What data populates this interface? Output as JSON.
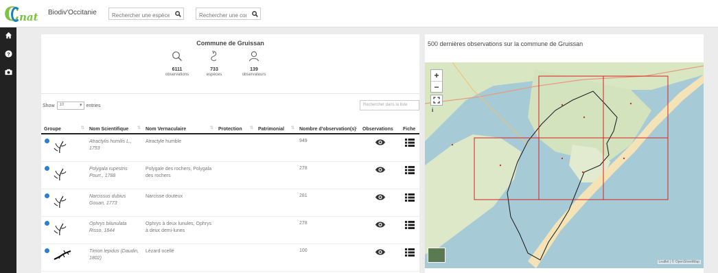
{
  "header": {
    "logo_text": "nat",
    "brand": "Biodiv'Occitanie",
    "search_species_placeholder": "Rechercher une espèce",
    "search_commune_placeholder": "Rechercher une commune"
  },
  "sidebar": {
    "items": [
      {
        "icon": "home-icon"
      },
      {
        "icon": "help-icon"
      },
      {
        "icon": "camera-icon"
      }
    ]
  },
  "commune": {
    "title": "Commune de Gruissan",
    "stats": [
      {
        "value": "6111",
        "label": "observations",
        "icon": "search-icon"
      },
      {
        "value": "733",
        "label": "espèces",
        "icon": "species-icon"
      },
      {
        "value": "139",
        "label": "observateurs",
        "icon": "user-icon"
      }
    ]
  },
  "table": {
    "show_label": "Show",
    "page_size": "10",
    "entries_label": "entries",
    "search_placeholder": "Rechercher dans la liste",
    "columns": {
      "groupe": "Groupe",
      "nom_scientifique": "Nom Scientifique",
      "nom_vernaculaire": "Nom Vernaculaire",
      "protection": "Protection",
      "patrimonial": "Patrimonial",
      "nombre": "Nombre d'observation(s)",
      "observations": "Observations",
      "fiche": "Fiche"
    },
    "rows": [
      {
        "scientific": "Atractylis humilis L., 1753",
        "vernacular": "Atractyle humble",
        "count": "949",
        "group_icon": "plant-icon"
      },
      {
        "scientific": "Polygala rupestris Pourr., 1788",
        "vernacular": "Polygale des rochers, Polygala des rochers",
        "count": "278",
        "group_icon": "plant-icon"
      },
      {
        "scientific": "Narcissus dubius Gouan, 1773",
        "vernacular": "Narcisse douteux",
        "count": "281",
        "group_icon": "plant-icon"
      },
      {
        "scientific": "Ophrys bilunulata Risso, 1844",
        "vernacular": "Ophrys à deux lunules, Ophrys à deux demi-lunes",
        "count": "278",
        "group_icon": "plant-icon"
      },
      {
        "scientific": "Timon lepidus (Daudin, 1802)",
        "vernacular": "Lézard ocellé",
        "count": "100",
        "group_icon": "lizard-icon"
      }
    ]
  },
  "map": {
    "title": "500 dernières observations sur la commune de Gruissan",
    "zoom_in": "+",
    "zoom_out": "−",
    "info": "i",
    "attribution": "Leaflet | © OpenStreetMap",
    "colors": {
      "sea": "#a7cbd6",
      "land": "#d8e6c2",
      "grid": "#d42020",
      "boundary": "#222222"
    }
  }
}
